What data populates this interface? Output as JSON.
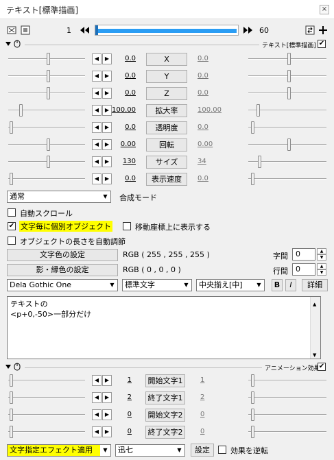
{
  "window": {
    "title": "テキスト[標準描画]",
    "close_glyph": "×"
  },
  "toolbar": {
    "frame_start": "1",
    "frame_end": "60"
  },
  "text_section": {
    "header_label": "テキスト[標準描画]"
  },
  "params": [
    {
      "name": "X",
      "value": "0.0",
      "end_value": "0.0"
    },
    {
      "name": "Y",
      "value": "0.0",
      "end_value": "0.0"
    },
    {
      "name": "Z",
      "value": "0.0",
      "end_value": "0.0"
    },
    {
      "name": "拡大率",
      "value": "100.00",
      "end_value": "100.00"
    },
    {
      "name": "透明度",
      "value": "0.0",
      "end_value": "0.0"
    },
    {
      "name": "回転",
      "value": "0.00",
      "end_value": "0.00"
    },
    {
      "name": "サイズ",
      "value": "130",
      "end_value": "34"
    },
    {
      "name": "表示速度",
      "value": "0.0",
      "end_value": "0.0"
    }
  ],
  "blend": {
    "value": "通常",
    "label": "合成モード"
  },
  "options": {
    "auto_scroll": "自動スクロール",
    "individual_object": "文字毎に個別オブジェクト",
    "show_on_move_coords": "移動座標上に表示する",
    "auto_adjust_length": "オブジェクトの長さを自動調節"
  },
  "colors": {
    "text_color_button": "文字色の設定",
    "text_color_value": "RGB ( 255 , 255 , 255 )",
    "shadow_color_button": "影・縁色の設定",
    "shadow_color_value": "RGB ( 0 , 0 , 0 )"
  },
  "spacing": {
    "char_label": "字間",
    "char_value": "0",
    "line_label": "行間",
    "line_value": "0"
  },
  "font": {
    "family": "Dela Gothic One",
    "style": "標準文字",
    "align": "中央揃え[中]",
    "bold": "B",
    "italic": "I",
    "detail": "詳細"
  },
  "text_content": {
    "line1": "テキストの",
    "line2": "<p+0,-50>一部分だけ"
  },
  "animation_section": {
    "header_label": "アニメーション効果"
  },
  "anim_params": [
    {
      "name": "開始文字1",
      "value": "1",
      "end_value": "1"
    },
    {
      "name": "終了文字1",
      "value": "2",
      "end_value": "2"
    },
    {
      "name": "開始文字2",
      "value": "0",
      "end_value": "0"
    },
    {
      "name": "終了文字2",
      "value": "0",
      "end_value": "0"
    }
  ],
  "effect": {
    "type": "文字指定エフェクト適用",
    "speed": "迅七",
    "settings_button": "設定",
    "reverse_label": "効果を逆転"
  },
  "accent": {
    "progress": "#2a9df4",
    "highlight": "#ffff00"
  }
}
